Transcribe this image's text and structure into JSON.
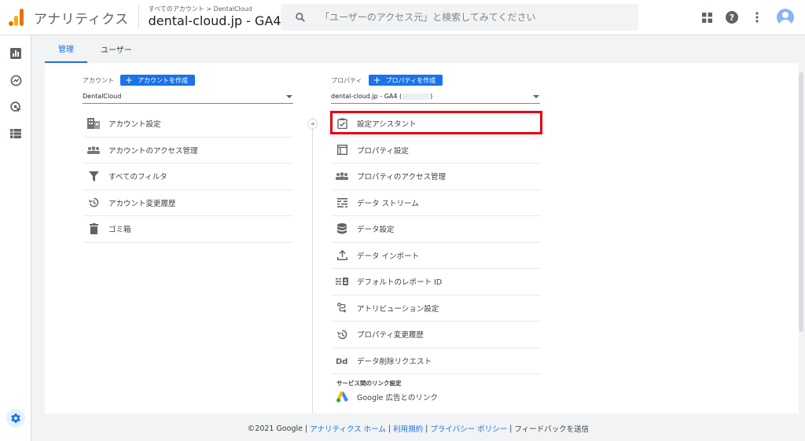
{
  "header": {
    "app_title": "アナリティクス",
    "breadcrumb": "すべてのアカウント > DentalCloud",
    "property_name": "dental-cloud.jp - GA4",
    "search_placeholder": "「ユーザーのアクセス元」と検索してみてください"
  },
  "tabs": [
    {
      "label": "管理",
      "active": true
    },
    {
      "label": "ユーザー",
      "active": false
    }
  ],
  "account": {
    "column_label": "アカウント",
    "create_button": "アカウントを作成",
    "selected": "DentalCloud",
    "items": [
      {
        "label": "アカウント設定",
        "icon": "building-icon"
      },
      {
        "label": "アカウントのアクセス管理",
        "icon": "people-icon"
      },
      {
        "label": "すべてのフィルタ",
        "icon": "filter-icon"
      },
      {
        "label": "アカウント変更履歴",
        "icon": "history-icon"
      },
      {
        "label": "ゴミ箱",
        "icon": "trash-icon"
      }
    ]
  },
  "property": {
    "column_label": "プロパティ",
    "create_button": "プロパティを作成",
    "selected_prefix": "dental-cloud.jp - GA4 (",
    "selected_suffix": ")",
    "items": [
      {
        "label": "設定アシスタント",
        "icon": "checklist-icon"
      },
      {
        "label": "プロパティ設定",
        "icon": "window-icon"
      },
      {
        "label": "プロパティのアクセス管理",
        "icon": "people-icon"
      },
      {
        "label": "データ ストリーム",
        "icon": "streams-icon"
      },
      {
        "label": "データ設定",
        "icon": "database-icon"
      },
      {
        "label": "データ インポート",
        "icon": "upload-icon"
      },
      {
        "label": "デフォルトのレポート ID",
        "icon": "report-id-icon"
      },
      {
        "label": "アトリビューション設定",
        "icon": "attribution-icon"
      },
      {
        "label": "プロパティ変更履歴",
        "icon": "history-icon"
      },
      {
        "label": "データ削除リクエスト",
        "icon": "dd-icon"
      }
    ],
    "section_label": "サービス間のリンク設定",
    "link_item": {
      "label": "Google 広告とのリンク",
      "icon": "google-ads-icon"
    }
  },
  "footer": {
    "copyright": "©2021 Google",
    "links": [
      "アナリティクス ホーム",
      "利用規約",
      "プライバシー ポリシー"
    ],
    "feedback": "フィードバックを送信"
  },
  "colors": {
    "accent": "#1a73e8",
    "highlight_box": "#e60012"
  }
}
